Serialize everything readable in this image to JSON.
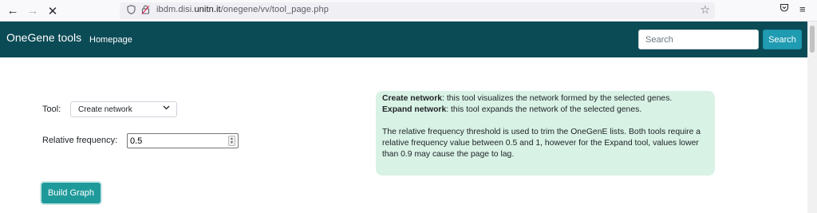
{
  "browser": {
    "back_icon": "arrow-left-icon",
    "forward_icon": "arrow-right-icon",
    "stop_icon": "close-icon",
    "url_prefix": "ibdm.disi.",
    "url_host": "unitn.it",
    "url_path": "/onegene/vv/tool_page.php"
  },
  "navbar": {
    "brand": "OneGene tools",
    "homepage_link": "Homepage",
    "search_placeholder": "Search",
    "search_button": "Search",
    "background_color": "#0b4b55",
    "accent_color": "#1f9bb2"
  },
  "form": {
    "tool_label": "Tool:",
    "tool_selected": "Create network",
    "frequency_label": "Relative frequency:",
    "frequency_value": "0.5",
    "build_button": "Build Graph"
  },
  "info": {
    "create_title": "Create network",
    "create_text": ": this tool visualizes the network formed by the selected genes.",
    "expand_title": "Expand network",
    "expand_text": ": this tool expands the network of the selected genes.",
    "line1": "The relative frequency threshold is used to trim the OneGenE lists. Both tools require a",
    "line2": "relative frequency value between 0.5 and 1, however for the Expand tool, values lower",
    "line3": "than 0.9 may cause the page to lag.",
    "background_color": "#d8f2e5"
  }
}
